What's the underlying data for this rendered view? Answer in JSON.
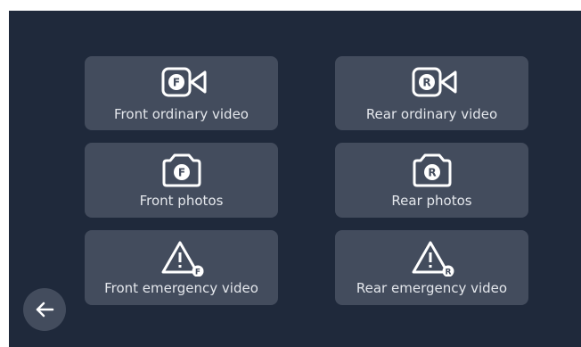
{
  "tiles": {
    "front_ordinary_video": {
      "label": "Front ordinary video",
      "badge": "F",
      "icon": "video-camera-icon"
    },
    "rear_ordinary_video": {
      "label": "Rear ordinary video",
      "badge": "R",
      "icon": "video-camera-icon"
    },
    "front_photos": {
      "label": "Front photos",
      "badge": "F",
      "icon": "camera-icon"
    },
    "rear_photos": {
      "label": "Rear photos",
      "badge": "R",
      "icon": "camera-icon"
    },
    "front_emergency_video": {
      "label": "Front emergency video",
      "badge": "F",
      "icon": "warning-icon"
    },
    "rear_emergency_video": {
      "label": "Rear emergency video",
      "badge": "R",
      "icon": "warning-icon"
    }
  },
  "back_button": {
    "icon": "arrow-left-icon"
  },
  "colors": {
    "background": "#1f293b",
    "tile": "#434c5d",
    "text": "#e4e7ec",
    "icon": "#ffffff"
  }
}
